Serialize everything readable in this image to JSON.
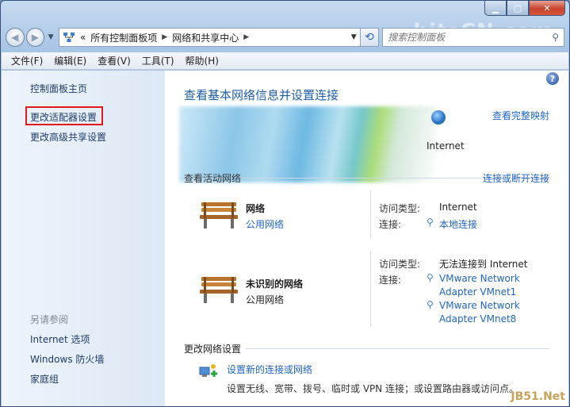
{
  "watermark_top": "bitsCN.com",
  "watermark_bottom": "JB51.Net",
  "address": {
    "prefix": "«",
    "crumbs": [
      "所有控制面板项",
      "网络和共享中心"
    ]
  },
  "search": {
    "placeholder": "搜索控制面板"
  },
  "menu": [
    "文件(F)",
    "编辑(E)",
    "查看(V)",
    "工具(T)",
    "帮助(H)"
  ],
  "sidebar": {
    "home": "控制面板主页",
    "adapter": "更改适配器设置",
    "advanced_sharing": "更改高级共享设置",
    "see_also": "另请参阅",
    "internet_options": "Internet 选项",
    "firewall": "Windows 防火墙",
    "homegroup": "家庭组"
  },
  "main": {
    "title": "查看基本网络信息并设置连接",
    "full_map": "查看完整映射",
    "internet_label": "Internet",
    "active_label": "查看活动网络",
    "connect_link": "连接或断开连接",
    "networks": [
      {
        "name": "网络",
        "type": "公用网络",
        "access_key": "访问类型:",
        "access_val": "Internet",
        "conn_key": "连接:",
        "conn_vals": [
          "本地连接"
        ]
      },
      {
        "name": "未识别的网络",
        "type": "公用网络",
        "access_key": "访问类型:",
        "access_val": "无法连接到 Internet",
        "conn_key": "连接:",
        "conn_vals": [
          "VMware Network",
          "Adapter VMnet1",
          "VMware Network",
          "Adapter VMnet8"
        ]
      }
    ],
    "change_label": "更改网络设置",
    "setup_link": "设置新的连接或网络",
    "setup_desc": "设置无线、宽带、拨号、临时或 VPN 连接；或设置路由器或访问点。"
  }
}
